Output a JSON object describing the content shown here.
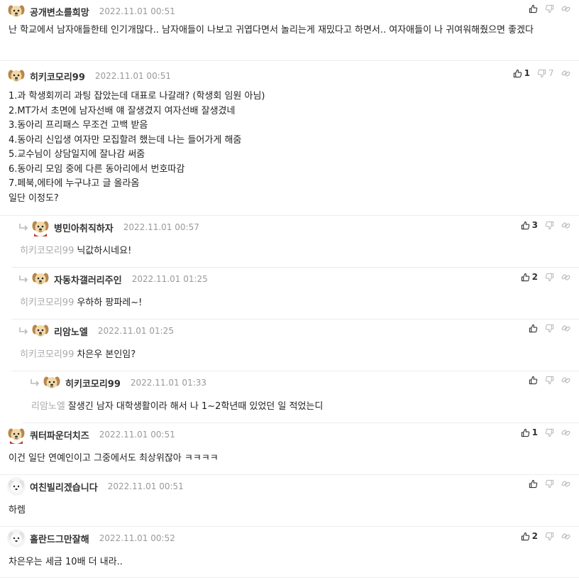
{
  "comments": [
    {
      "nick": "공개변소를희망",
      "date": "2022.11.01 00:51",
      "likes": "",
      "dislikes": "",
      "avatar": "dog",
      "text": "난 학교에서 남자애들한테 인기개많다.. 남자애들이 나보고 귀엽다면서 놀리는게 재밌다고 하면서.. 여자애들이 나 귀여워해줬으면 좋겠다"
    },
    {
      "nick": "히키코모리99",
      "date": "2022.11.01 00:51",
      "likes": "1",
      "dislikes": "7",
      "avatar": "dog",
      "text": "1.과 학생회끼리 과팅 잡았는데 대표로 나갈래? (학생회 임원 아님)\n2.MT가서 초면에 남자선배 얘 잘생겼지 여자선배 잘생겼네\n3.동아리 프리패스 무조건 고백 받음\n4.동아리 신입생 여자만 모집할려 했는데 나는 들어가게 해줌\n5.교수님이 상담일지에 잘나감 써줌\n6.동아리 모임 중에 다른 동아리에서 번호따감\n7.페북,에타에 누구냐고 글 올라옴\n일단 이정도?"
    },
    {
      "nick": "병민아취직하자",
      "date": "2022.11.01 00:57",
      "likes": "3",
      "dislikes": "",
      "avatar": "dog-red",
      "mention": "히키코모리99",
      "text": "닉값하시네요!"
    },
    {
      "nick": "자동차갤러리주인",
      "date": "2022.11.01 01:25",
      "likes": "2",
      "dislikes": "",
      "avatar": "dog",
      "mention": "히키코모리99",
      "text": "우하하 팡파레~!"
    },
    {
      "nick": "리암노엘",
      "date": "2022.11.01 01:25",
      "likes": "",
      "dislikes": "",
      "avatar": "dog",
      "mention": "히키코모리99",
      "text": "차은우 본인임?"
    },
    {
      "nick": "히키코모리99",
      "date": "2022.11.01 01:33",
      "likes": "",
      "dislikes": "",
      "avatar": "dog",
      "mention": "리암노엘",
      "text": "잘생긴 남자 대학생활이라 해서 나 1~2학년때 있었던 일 적었는디"
    },
    {
      "nick": "쿼터파운더치즈",
      "date": "2022.11.01 00:51",
      "likes": "1",
      "dislikes": "",
      "avatar": "dog-red",
      "text": "이건 일단 연예인이고 그중에서도 최상위잖아 ㅋㅋㅋㅋ"
    },
    {
      "nick": "여친빌리겠습니다",
      "date": "2022.11.01 00:51",
      "likes": "",
      "dislikes": "",
      "avatar": "white-dog",
      "text": "하렘"
    },
    {
      "nick": "홀란드그만잘해",
      "date": "2022.11.01 00:52",
      "likes": "2",
      "dislikes": "",
      "avatar": "white-dog",
      "text": "차은우는 세금 10배 더 내라.."
    }
  ]
}
